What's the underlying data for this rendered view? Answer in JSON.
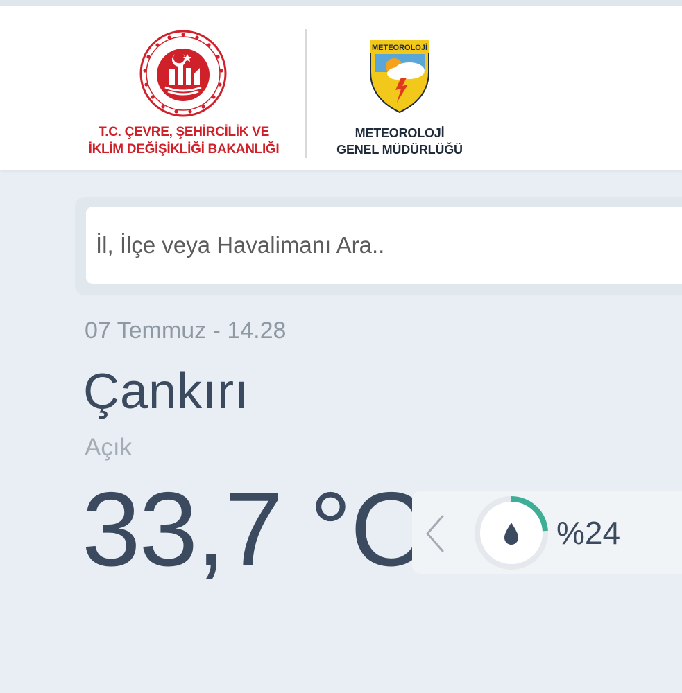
{
  "header": {
    "ministry_line1": "T.C. ÇEVRE, ŞEHİRCİLİK VE",
    "ministry_line2": "İKLİM DEĞİŞİKLİĞİ BAKANLIĞI",
    "mgm_logo_text": "METEOROLOJİ",
    "mgm_line1": "METEOROLOJİ",
    "mgm_line2": "GENEL MÜDÜRLÜĞÜ",
    "ministry_logo_icon": "ministry-emblem-icon",
    "mgm_logo_icon": "meteorology-shield-icon"
  },
  "search": {
    "placeholder": "İl, İlçe veya Havalimanı Ara..",
    "value": ""
  },
  "weather": {
    "datetime": "07 Temmuz - 14.28",
    "city": "Çankırı",
    "condition": "Açık",
    "temperature": "33,7 °C",
    "humidity_label": "%24",
    "humidity_percent": 24,
    "prev_icon": "chevron-left-icon",
    "humidity_icon": "water-drop-icon"
  },
  "colors": {
    "ministry_red": "#d0202a",
    "text_dark": "#3b4a5e",
    "text_muted": "#8f99a3",
    "background": "#e8eef3",
    "humidity_accent": "#3fae97"
  }
}
